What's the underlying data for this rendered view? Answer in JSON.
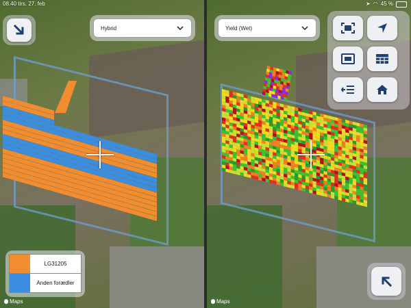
{
  "status_bar": {
    "time_date": "08.40  tirs. 27. feb",
    "battery": "45 %"
  },
  "left": {
    "dropdown_value": "Hybrid",
    "legend": [
      {
        "label": "LG31205",
        "color": "#f28c30"
      },
      {
        "label": "Anden forædler",
        "color": "#3b8de0"
      }
    ],
    "maps_label": "Maps",
    "icons": {
      "corner": "arrow-down-right-icon"
    }
  },
  "right": {
    "dropdown_value": "Yield (Wet)",
    "maps_label": "Maps",
    "buttons": [
      {
        "name": "fit-extent-button",
        "icon": "fit-extent-icon"
      },
      {
        "name": "locate-button",
        "icon": "location-arrow-icon"
      },
      {
        "name": "screen-cast-button",
        "icon": "screen-icon"
      },
      {
        "name": "table-button",
        "icon": "table-icon"
      },
      {
        "name": "layers-list-button",
        "icon": "list-arrow-icon"
      },
      {
        "name": "home-button",
        "icon": "home-icon"
      }
    ],
    "corner_icon": "arrow-up-left-icon"
  },
  "colors": {
    "hybrid_a": "#f28c30",
    "hybrid_b": "#3b8de0",
    "yield_scale": [
      "#b01020",
      "#e03020",
      "#f08020",
      "#f8d820",
      "#c8e030",
      "#40c030",
      "#2a9a2a"
    ]
  }
}
